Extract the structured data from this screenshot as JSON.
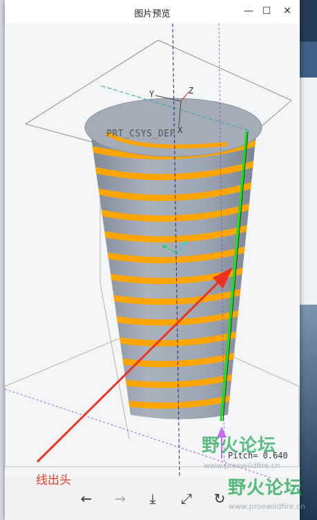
{
  "window": {
    "title": "图片预览",
    "controls": {
      "minimize": "—",
      "maximize": "☐",
      "close": "✕"
    }
  },
  "model": {
    "csys_label": "PRT_CSYS_DEF",
    "axis_labels": {
      "x": "X",
      "y": "Y",
      "z": "Z"
    },
    "pitch_text": "Pitch= 0.640",
    "colors": {
      "body": "#a4adb8",
      "helix": "#ffa500",
      "sweep": "#19e019",
      "arrow": "#f03020"
    }
  },
  "annotation": {
    "callout_text": "线出头"
  },
  "watermarks": [
    {
      "text": "野火论坛",
      "url": "www.proewildfire.cn"
    },
    {
      "text": "野火论坛",
      "url": "www.proewildfire.cn"
    }
  ],
  "toolbar": {
    "back_icon": "←",
    "forward_icon": "→",
    "download_icon": "⤓",
    "fullscreen_icon": "⤢",
    "rotate_icon": "↻"
  }
}
